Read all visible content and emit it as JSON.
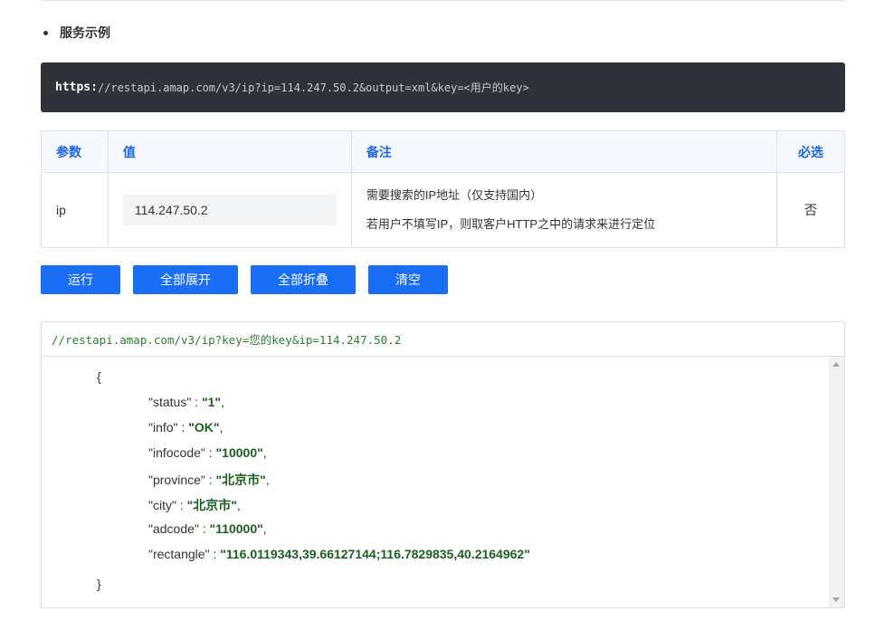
{
  "section": {
    "title": "服务示例"
  },
  "request": {
    "protocol": "https:",
    "path": "//restapi.amap.com/v3/ip?ip=114.247.50.2&output=xml&key=<用户的key>"
  },
  "table": {
    "headers": {
      "param": "参数",
      "value": "值",
      "note": "备注",
      "required": "必选"
    },
    "row": {
      "param": "ip",
      "value": "114.247.50.2",
      "note_line1": "需要搜索的IP地址（仅支持国内）",
      "note_line2": "若用户不填写IP，则取客户HTTP之中的请求来进行定位",
      "required": "否"
    }
  },
  "buttons": {
    "run": "运行",
    "expand_all": "全部展开",
    "collapse_all": "全部折叠",
    "clear": "清空"
  },
  "result": {
    "url": "//restapi.amap.com/v3/ip?key=您的key&ip=114.247.50.2",
    "open_brace": "{",
    "close_brace": "}",
    "fields": [
      {
        "key": "\"status\"",
        "value": "\"1\""
      },
      {
        "key": "\"info\"",
        "value": "\"OK\""
      },
      {
        "key": "\"infocode\"",
        "value": "\"10000\""
      },
      {
        "key": "\"province\"",
        "value": "\"北京市\""
      },
      {
        "key": "\"city\"",
        "value": "\"北京市\""
      },
      {
        "key": "\"adcode\"",
        "value": "\"110000\""
      },
      {
        "key": "\"rectangle\"",
        "value": "\"116.0119343,39.66127144;116.7829835,40.2164962\""
      }
    ]
  }
}
